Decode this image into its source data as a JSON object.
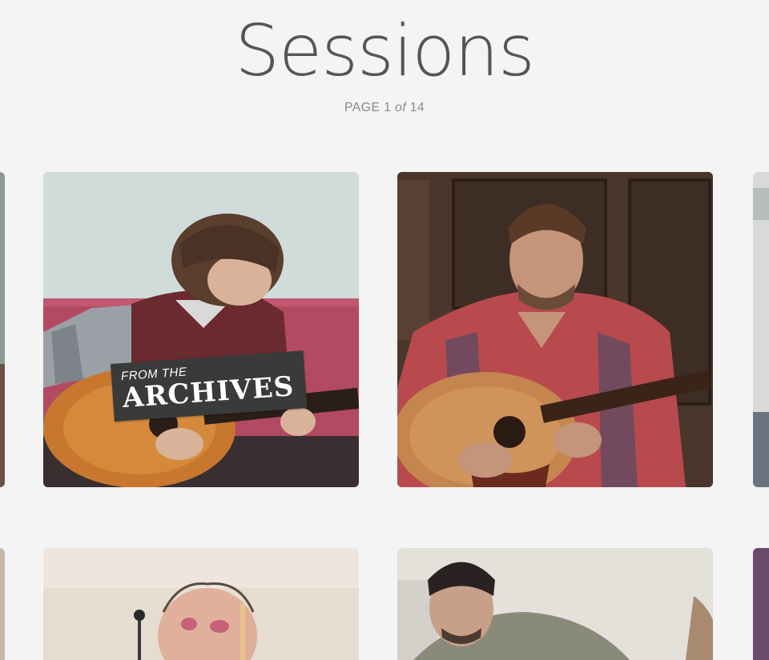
{
  "header": {
    "title": "Sessions",
    "page_prefix": "PAGE",
    "page_current": "1",
    "page_of": "of",
    "page_total": "14"
  },
  "sessions": [
    {
      "badge_small": "FROM THE",
      "badge_big": "ARCHIVES"
    }
  ],
  "colors": {
    "background": "#f4f4f4",
    "title": "#555555",
    "badge": "#3a3a3a"
  }
}
